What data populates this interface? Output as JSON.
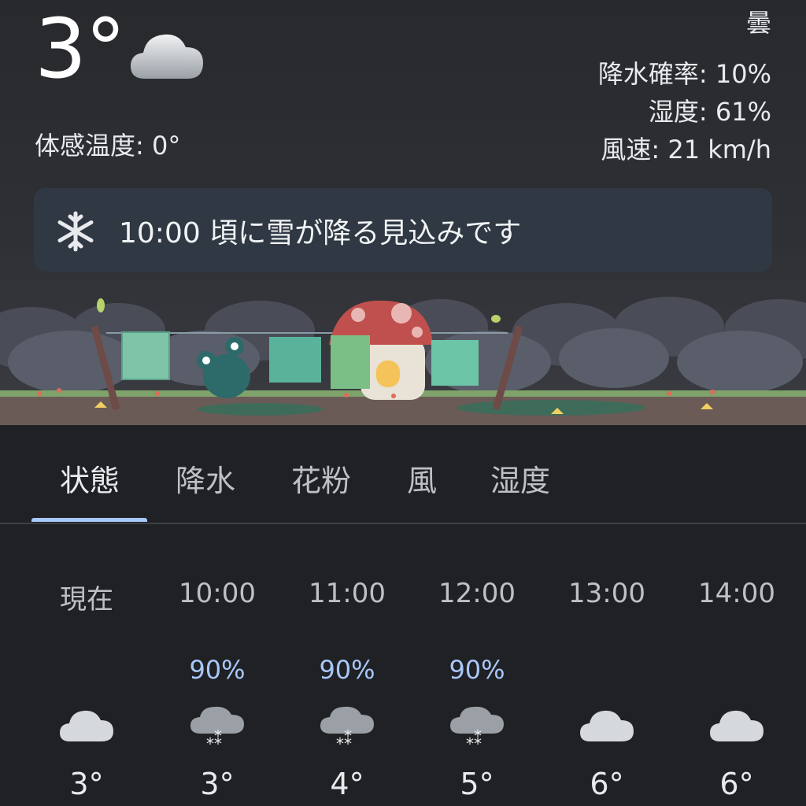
{
  "current": {
    "temperature": "3°",
    "condition": "曇",
    "feels_like": "体感温度: 0°",
    "precip_chance": "降水確率: 10%",
    "humidity": "湿度: 61%",
    "wind": "風速: 21 km/h",
    "icon": "cloud-icon"
  },
  "alert": {
    "text": "10:00 頃に雪が降る見込みです",
    "icon": "snowflake-icon"
  },
  "tabs": [
    {
      "label": "状態",
      "active": true
    },
    {
      "label": "降水",
      "active": false
    },
    {
      "label": "花粉",
      "active": false
    },
    {
      "label": "風",
      "active": false
    },
    {
      "label": "湿度",
      "active": false
    }
  ],
  "hourly": [
    {
      "time": "現在",
      "prob": "",
      "icon": "cloud-icon",
      "temp": "3°"
    },
    {
      "time": "10:00",
      "prob": "90%",
      "icon": "cloud-snow-icon",
      "temp": "3°"
    },
    {
      "time": "11:00",
      "prob": "90%",
      "icon": "cloud-snow-icon",
      "temp": "4°"
    },
    {
      "time": "12:00",
      "prob": "90%",
      "icon": "cloud-snow-icon",
      "temp": "5°"
    },
    {
      "time": "13:00",
      "prob": "",
      "icon": "cloud-icon",
      "temp": "6°"
    },
    {
      "time": "14:00",
      "prob": "",
      "icon": "cloud-icon",
      "temp": "6°"
    }
  ],
  "colors": {
    "background": "#202124",
    "accent": "#a8c7fa",
    "alert_bg": "#303844"
  }
}
